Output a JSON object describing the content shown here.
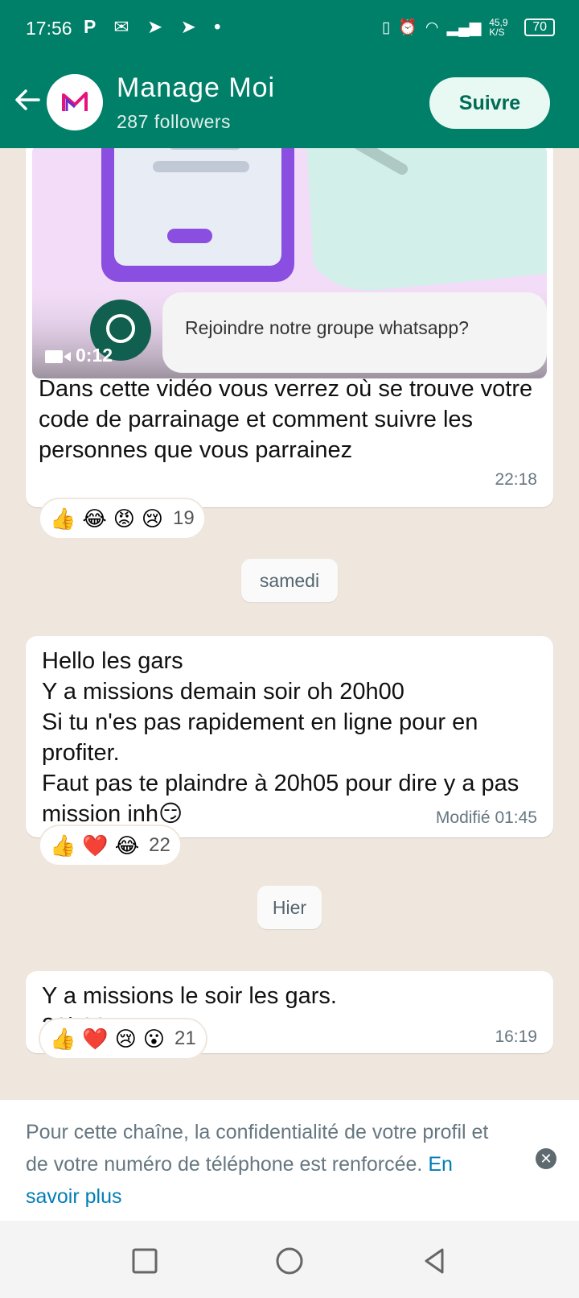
{
  "status": {
    "time": "17:56",
    "apps": "P ✉ ➤ ➤ •",
    "net_speed": "45,9 K/S",
    "battery": "70"
  },
  "header": {
    "channel_name": "Manage Moi",
    "followers": "287 followers",
    "follow_label": "Suivre"
  },
  "messages": [
    {
      "video_duration": "0:12",
      "video_caption": "Rejoindre notre groupe whatsapp?",
      "text": "Dans cette vidéo vous verrez où se trouve votre code de parrainage et comment suivre les personnes que vous parrainez",
      "time": "22:18",
      "reactions": [
        "👍",
        "😂",
        "😡",
        "😢"
      ],
      "reaction_count": "19"
    },
    {
      "text": "Hello les gars\nY a missions demain soir oh 20h00\nSi tu n'es pas rapidement en ligne pour en profiter.\nFaut pas te plaindre à 20h05 pour dire y a pas mission inh😏",
      "edited": "Modifié",
      "time": "01:45",
      "reactions": [
        "👍",
        "❤️",
        "😂"
      ],
      "reaction_count": "22"
    },
    {
      "text": "Y a missions le soir les gars.\n20h30",
      "time": "16:19",
      "reactions": [
        "👍",
        "❤️",
        "😢",
        "😮"
      ],
      "reaction_count": "21"
    }
  ],
  "date_chips": [
    "samedi",
    "Hier"
  ],
  "privacy": {
    "text": "Pour cette chaîne, la confidentialité de votre profil et de votre numéro de téléphone est renforcée.",
    "link": "En savoir plus"
  },
  "colors": {
    "header": "#008069",
    "chat_bg": "#efe7de",
    "follow_btn_bg": "#e8f8f2",
    "link": "#027eb5"
  }
}
